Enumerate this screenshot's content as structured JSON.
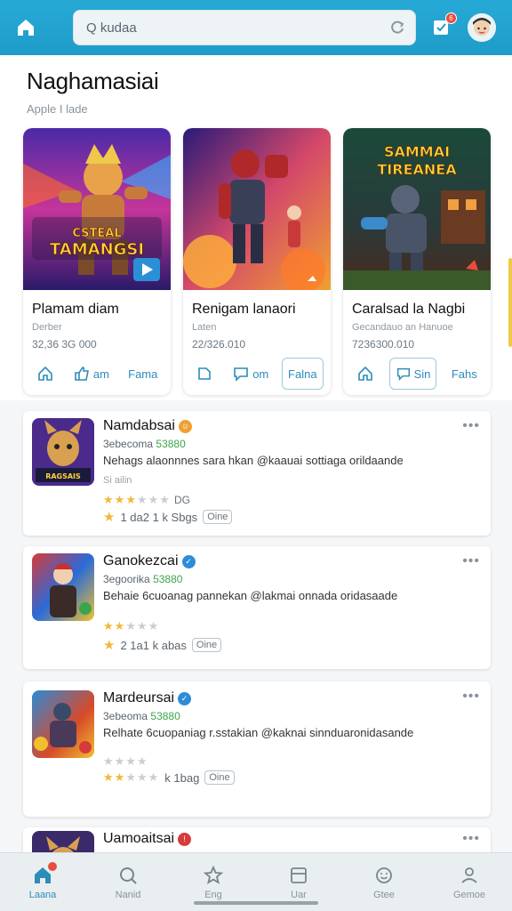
{
  "colors": {
    "accent": "#1f9cc9",
    "link": "#2d8cb8",
    "star": "#f2b83a",
    "badge": "#e84c3d",
    "green": "#3da54b"
  },
  "topbar": {
    "search_placeholder": "Q kudaa",
    "notification_badge": "6"
  },
  "header": {
    "title": "Naghamasiai",
    "subtitle": "Apple I lade"
  },
  "featured": [
    {
      "name": "Plamam diam",
      "sub": "Derber",
      "meta": "32,36 3G 000",
      "art_text": "CSTEAL TAMANGSI",
      "actions": [
        {
          "icon": "home-icon",
          "label": ""
        },
        {
          "icon": "thumb-icon",
          "label": "am"
        },
        {
          "icon": "",
          "label": "Fama"
        }
      ]
    },
    {
      "name": "Renigam lanaori",
      "sub": "Laten",
      "meta": "22/326.010",
      "art_text": "",
      "actions": [
        {
          "icon": "bookmark-icon",
          "label": ""
        },
        {
          "icon": "comment-icon",
          "label": "om"
        },
        {
          "icon": "",
          "label": "Falna"
        }
      ]
    },
    {
      "name": "Caralsad la Nagbi",
      "sub": "Gecandauo an Hanuoe",
      "meta": "7236300.010",
      "art_text": "SAMMAI TIREANEA",
      "actions": [
        {
          "icon": "home-icon",
          "label": ""
        },
        {
          "icon": "chat-icon",
          "label": "Sin"
        },
        {
          "icon": "",
          "label": "Fahs"
        }
      ]
    }
  ],
  "list": [
    {
      "name": "Namdabsai",
      "sub_prefix": "3ebecoma",
      "sub_green": "53880",
      "desc": "Nehags alaonnnes sara hkan @kaauai sottiaga orildaande",
      "tag": "Si ailin",
      "rating": 2.5,
      "rating_count": "DG",
      "meta_text": "1 da2 1 k Sbgs",
      "chip": "Oine"
    },
    {
      "name": "Ganokezcai",
      "sub_prefix": "3egoorika",
      "sub_green": "53880",
      "desc": "Behaie 6cuoanag pannekan @lakmai onnada oridasaade",
      "tag": "",
      "rating": 2,
      "rating_count": "",
      "meta_text": "2 1a1 k abas",
      "chip": "Oine"
    },
    {
      "name": "Mardeursai",
      "sub_prefix": "3ebeoma",
      "sub_green": "53880",
      "desc": "Relhate 6cuopaniag r.sstakian @kaknai sinnduaronidasande",
      "tag": "",
      "rating": 2.5,
      "rating_count": "",
      "meta_text": "k 1bag",
      "chip": "Oine"
    },
    {
      "name": "Uamoaitsai",
      "sub_prefix": "",
      "sub_green": "",
      "desc": "",
      "tag": "",
      "rating": 0,
      "rating_count": "",
      "meta_text": "",
      "chip": ""
    }
  ],
  "bottom_nav": [
    {
      "icon": "home-icon",
      "label": "Laana",
      "active": true,
      "badge": true
    },
    {
      "icon": "search-icon",
      "label": "Nanid",
      "active": false,
      "badge": false
    },
    {
      "icon": "star-icon",
      "label": "Eng",
      "active": false,
      "badge": false
    },
    {
      "icon": "library-icon",
      "label": "Uar",
      "active": false,
      "badge": false
    },
    {
      "icon": "smile-icon",
      "label": "Gtee",
      "active": false,
      "badge": false
    },
    {
      "icon": "user-icon",
      "label": "Gemoe",
      "active": false,
      "badge": false
    }
  ]
}
